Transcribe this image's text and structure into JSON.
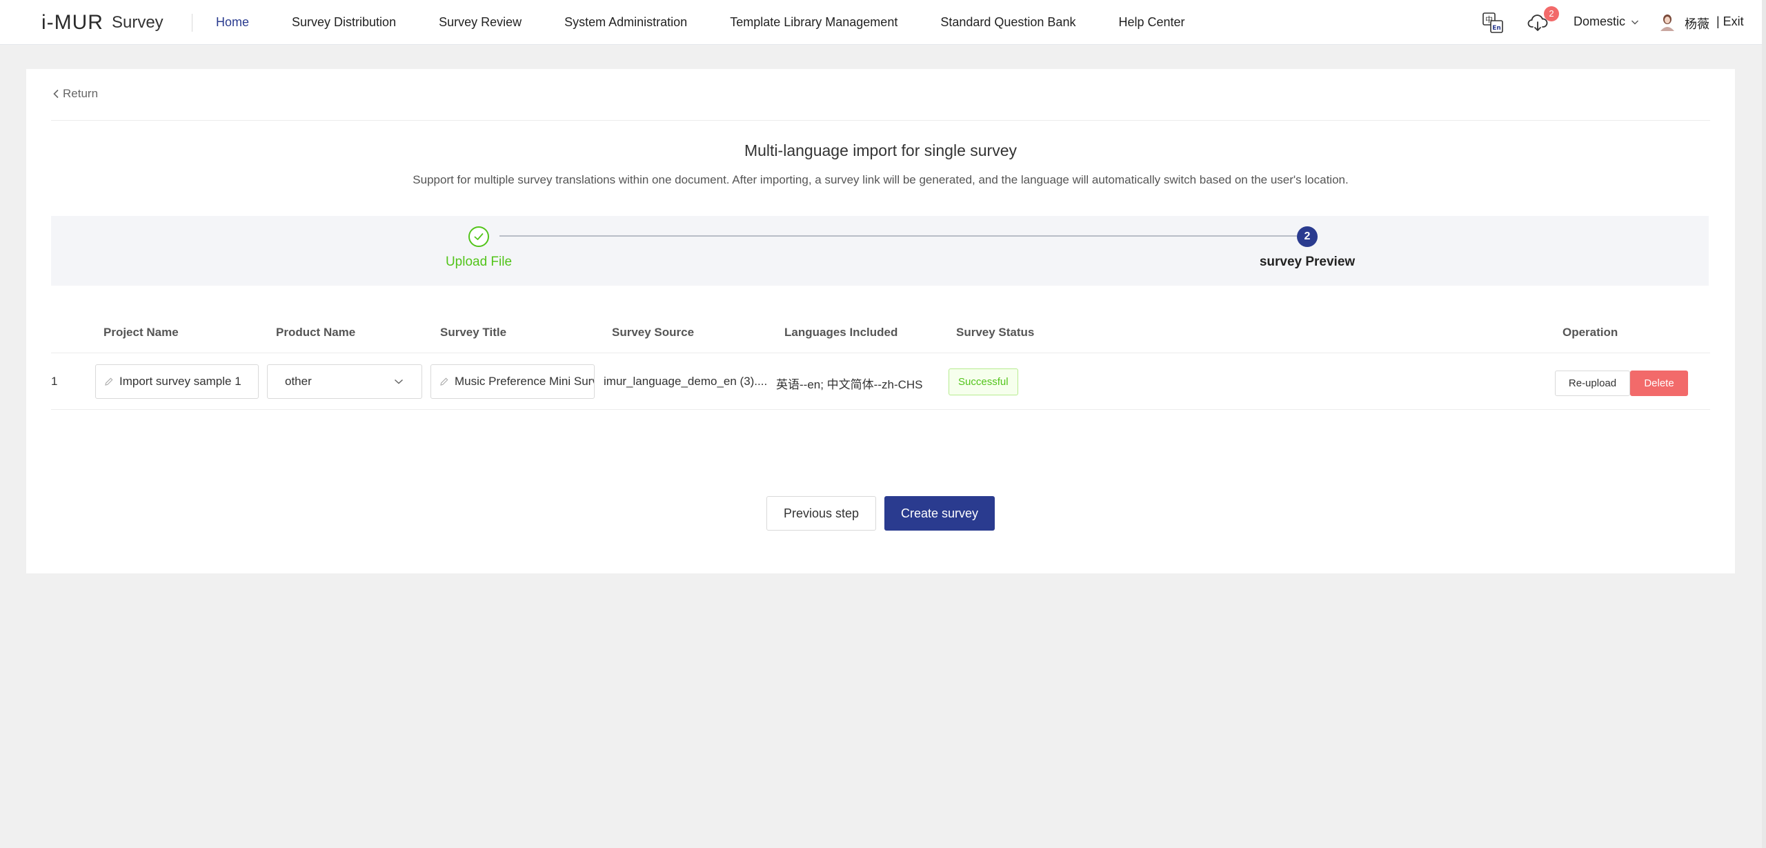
{
  "header": {
    "logo_mark": "i-MUR",
    "app_name": "Survey",
    "nav": [
      {
        "label": "Home",
        "active": true
      },
      {
        "label": "Survey Distribution"
      },
      {
        "label": "Survey Review"
      },
      {
        "label": "System Administration"
      },
      {
        "label": "Template Library Management"
      },
      {
        "label": "Standard Question Bank"
      },
      {
        "label": "Help Center"
      }
    ],
    "notification_count": "2",
    "region": "Domestic",
    "username": "杨薇",
    "exit_label": "| Exit"
  },
  "page": {
    "return_label": "Return",
    "title": "Multi-language import for single survey",
    "subtitle": "Support for multiple survey translations within one document. After importing, a survey link will be generated, and the language will automatically switch based on the user's location."
  },
  "steps": [
    {
      "number": "1",
      "label": "Upload File",
      "status": "done"
    },
    {
      "number": "2",
      "label": "survey Preview",
      "status": "active"
    }
  ],
  "table": {
    "columns": [
      "Project Name",
      "Product Name",
      "Survey Title",
      "Survey Source",
      "Languages Included",
      "Survey Status",
      "Operation"
    ],
    "rows": [
      {
        "index": "1",
        "project_name": "Import survey sample 1",
        "product_name": "other",
        "survey_title": "Music Preference Mini Survey",
        "survey_source": "imur_language_demo_en (3)....",
        "languages": "英语--en; 中文简体--zh-CHS",
        "status": "Successful",
        "reupload_label": "Re-upload",
        "delete_label": "Delete"
      }
    ]
  },
  "footer": {
    "prev_label": "Previous step",
    "create_label": "Create survey"
  },
  "colors": {
    "brand": "#2a3b8f",
    "success": "#52c41a",
    "danger": "#f26a6a",
    "accent": "#f5a623"
  }
}
